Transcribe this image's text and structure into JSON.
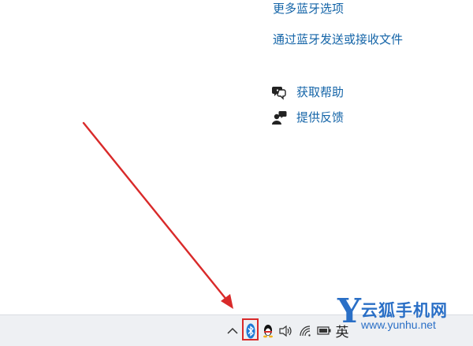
{
  "links": {
    "more_bluetooth": "更多蓝牙选项",
    "send_receive_files": "通过蓝牙发送或接收文件"
  },
  "help": {
    "get_help": "获取帮助",
    "give_feedback": "提供反馈",
    "get_help_icon": "help-chat-icon",
    "feedback_icon": "feedback-person-icon"
  },
  "taskbar": {
    "show_hidden_icon": "chevron-up-icon",
    "bluetooth_icon": "bluetooth-icon",
    "qq_icon": "qq-penguin-icon",
    "volume_icon": "speaker-icon",
    "wifi_icon": "wifi-icon",
    "battery_icon": "battery-icon",
    "ime_label": "英"
  },
  "watermark": {
    "letter": "Y",
    "name": "云狐手机网",
    "url": "www.yunhu.net"
  },
  "colors": {
    "link": "#1565a8",
    "arrow": "#d92a2a",
    "highlight_box": "#d92a2a",
    "watermark": "#2a6fc6"
  }
}
